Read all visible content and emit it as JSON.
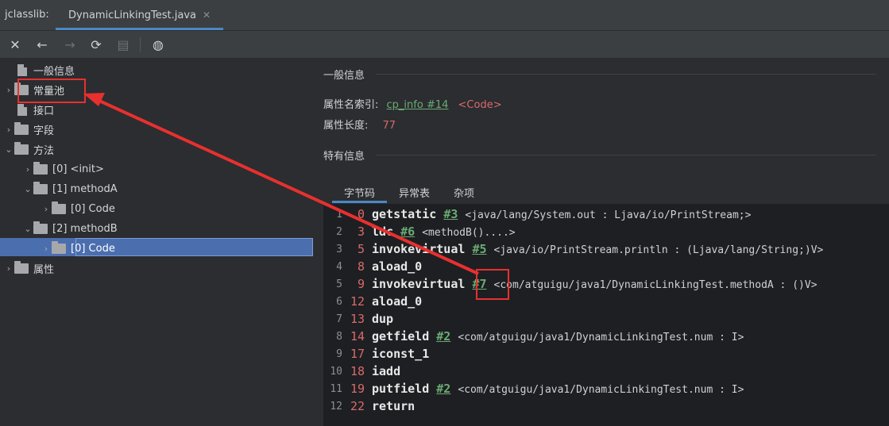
{
  "app": {
    "name": "jclasslib:"
  },
  "tab": {
    "title": "DynamicLinkingTest.java",
    "close": "✕"
  },
  "toolbar": {
    "close": "✕",
    "back": "←",
    "forward": "→",
    "refresh": "⟳",
    "save": "▤",
    "web": "◍"
  },
  "tree": [
    {
      "label": "一般信息",
      "type": "file",
      "expand": ""
    },
    {
      "label": "常量池",
      "type": "folder",
      "expand": "›"
    },
    {
      "label": "接口",
      "type": "file",
      "expand": ""
    },
    {
      "label": "字段",
      "type": "folder",
      "expand": "›"
    },
    {
      "label": "方法",
      "type": "folder",
      "expand": "⌄"
    },
    {
      "label": "[0] <init>",
      "type": "folder",
      "expand": "›"
    },
    {
      "label": "[1] methodA",
      "type": "folder",
      "expand": "⌄"
    },
    {
      "label": "[0] Code",
      "type": "folder",
      "expand": "›"
    },
    {
      "label": "[2] methodB",
      "type": "folder",
      "expand": "⌄"
    },
    {
      "label": "[0] Code",
      "type": "folder",
      "expand": "›"
    },
    {
      "label": "属性",
      "type": "folder",
      "expand": "›"
    }
  ],
  "general": {
    "title": "一般信息",
    "attr_name_label": "属性名索引:",
    "attr_name_link": "cp_info #14",
    "attr_name_tag": "<Code>",
    "attr_len_label": "属性长度:",
    "attr_len_value": "77"
  },
  "specific": {
    "title": "特有信息"
  },
  "subtabs": [
    "字节码",
    "异常表",
    "杂项"
  ],
  "bytecode": [
    {
      "line": "1",
      "offset": "0",
      "op": "getstatic",
      "ref": "#3",
      "comment": "<java/lang/System.out : Ljava/io/PrintStream;>"
    },
    {
      "line": "2",
      "offset": "3",
      "op": "ldc",
      "ref": "#6",
      "comment": "<methodB()....>"
    },
    {
      "line": "3",
      "offset": "5",
      "op": "invokevirtual",
      "ref": "#5",
      "comment": "<java/io/PrintStream.println : (Ljava/lang/String;)V>"
    },
    {
      "line": "4",
      "offset": "8",
      "op": "aload_0",
      "ref": "",
      "comment": ""
    },
    {
      "line": "5",
      "offset": "9",
      "op": "invokevirtual",
      "ref": "#7",
      "comment": "<com/atguigu/java1/DynamicLinkingTest.methodA : ()V>"
    },
    {
      "line": "6",
      "offset": "12",
      "op": "aload_0",
      "ref": "",
      "comment": ""
    },
    {
      "line": "7",
      "offset": "13",
      "op": "dup",
      "ref": "",
      "comment": ""
    },
    {
      "line": "8",
      "offset": "14",
      "op": "getfield",
      "ref": "#2",
      "comment": "<com/atguigu/java1/DynamicLinkingTest.num : I>"
    },
    {
      "line": "9",
      "offset": "17",
      "op": "iconst_1",
      "ref": "",
      "comment": ""
    },
    {
      "line": "10",
      "offset": "18",
      "op": "iadd",
      "ref": "",
      "comment": ""
    },
    {
      "line": "11",
      "offset": "19",
      "op": "putfield",
      "ref": "#2",
      "comment": "<com/atguigu/java1/DynamicLinkingTest.num : I>"
    },
    {
      "line": "12",
      "offset": "22",
      "op": "return",
      "ref": "",
      "comment": ""
    }
  ],
  "colors": {
    "accent": "#4a88c7",
    "selection": "#4b6eaf",
    "annotation": "#e8302f",
    "link": "#6aab73",
    "number": "#d86a6a"
  }
}
